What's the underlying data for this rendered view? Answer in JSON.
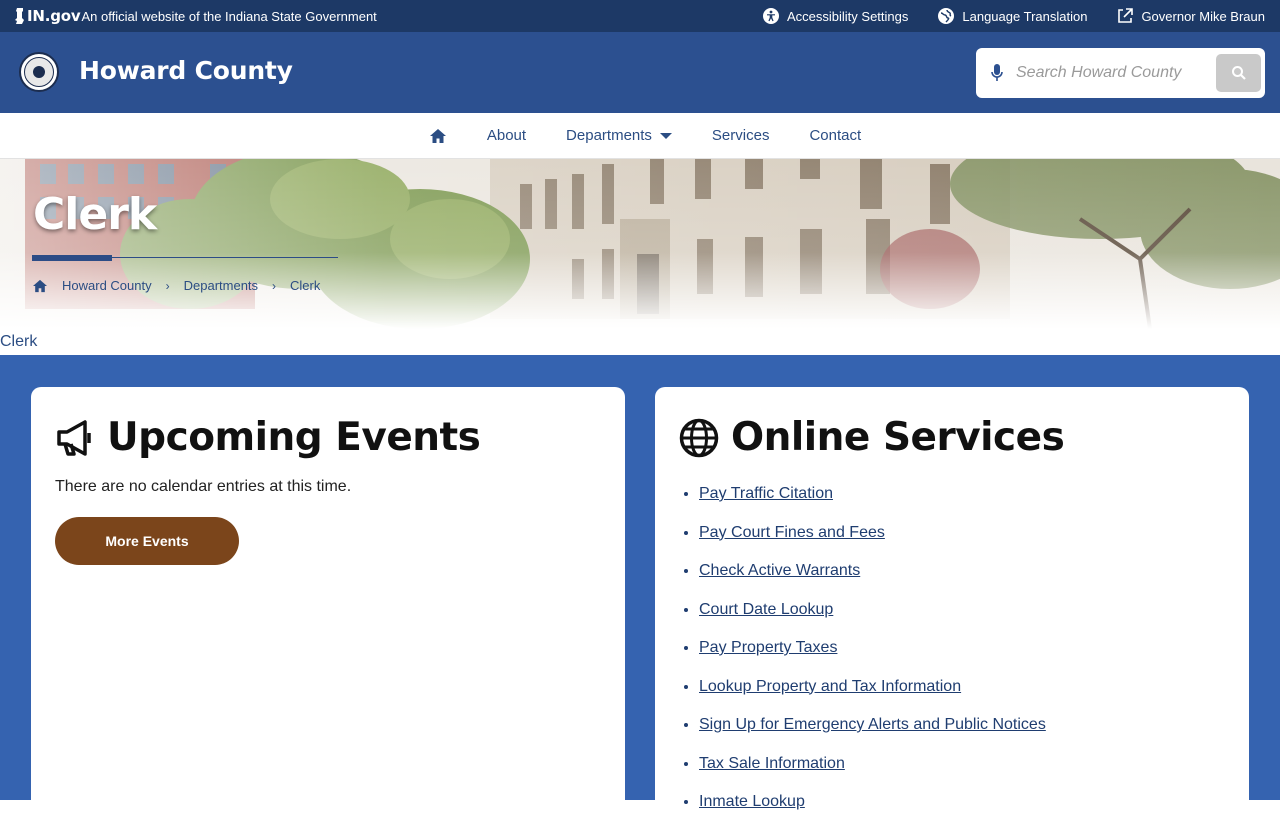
{
  "statebar": {
    "brand": "IN.gov",
    "official": "An official website of the Indiana State Government",
    "links": [
      {
        "label": "Accessibility Settings",
        "icon": "accessibility-icon"
      },
      {
        "label": "Language Translation",
        "icon": "globe-icon"
      },
      {
        "label": "Governor Mike Braun",
        "icon": "external-link-icon"
      }
    ]
  },
  "header": {
    "title": "Howard County",
    "search_placeholder": "Search Howard County"
  },
  "nav": {
    "items": [
      "About",
      "Departments",
      "Services",
      "Contact"
    ]
  },
  "hero": {
    "title": "Clerk",
    "breadcrumbs": [
      "Howard County",
      "Departments",
      "Clerk"
    ]
  },
  "page_label": "Clerk",
  "events": {
    "heading": "Upcoming Events",
    "note": "There are no calendar entries at this time.",
    "button": "More Events"
  },
  "services": {
    "heading": "Online Services",
    "links": [
      "Pay Traffic Citation",
      "Pay Court Fines and Fees",
      "Check Active Warrants",
      "Court Date Lookup",
      "Pay Property Taxes",
      "Lookup Property and Tax Information",
      "Sign Up for Emergency Alerts and Public Notices",
      "Tax Sale Information",
      "Inmate Lookup"
    ]
  },
  "colors": {
    "statebar": "#1d3966",
    "header": "#2c5090",
    "main_bg": "#3563b0",
    "button": "#7b451b",
    "link": "#1f3d70"
  }
}
